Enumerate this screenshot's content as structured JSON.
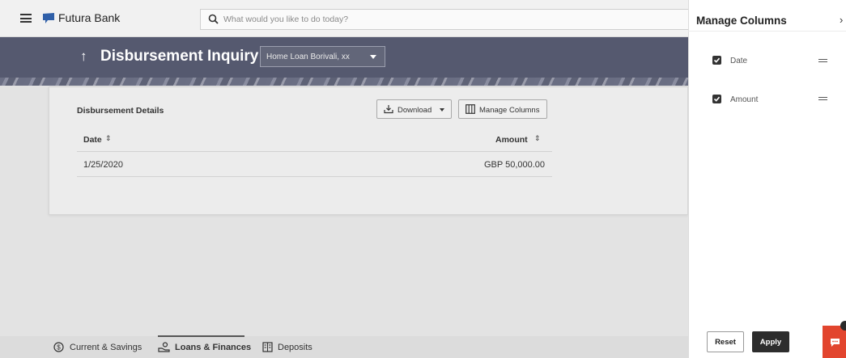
{
  "header": {
    "brand": "Futura Bank",
    "search_placeholder": "What would you like to do today?"
  },
  "page": {
    "title": "Disbursement Inquiry",
    "account": "Home Loan Borivali, xx"
  },
  "card": {
    "title": "Disbursement Details",
    "download_label": "Download",
    "manage_columns_label": "Manage Columns",
    "columns": [
      "Date",
      "Amount"
    ],
    "rows": [
      {
        "date": "1/25/2020",
        "amount": "GBP 50,000.00"
      }
    ]
  },
  "tabs": [
    {
      "label": "Current & Savings",
      "icon": "dollar-circle-icon"
    },
    {
      "label": "Loans & Finances",
      "icon": "loan-hand-icon"
    },
    {
      "label": "Deposits",
      "icon": "deposits-icon"
    }
  ],
  "panel": {
    "title": "Manage Columns",
    "close": "›",
    "columns": [
      {
        "label": "Date",
        "checked": true
      },
      {
        "label": "Amount",
        "checked": true
      }
    ],
    "reset_label": "Reset",
    "apply_label": "Apply"
  },
  "colors": {
    "banner": "#55596f",
    "apply": "#2d2d2d",
    "chat": "#e2452e"
  }
}
